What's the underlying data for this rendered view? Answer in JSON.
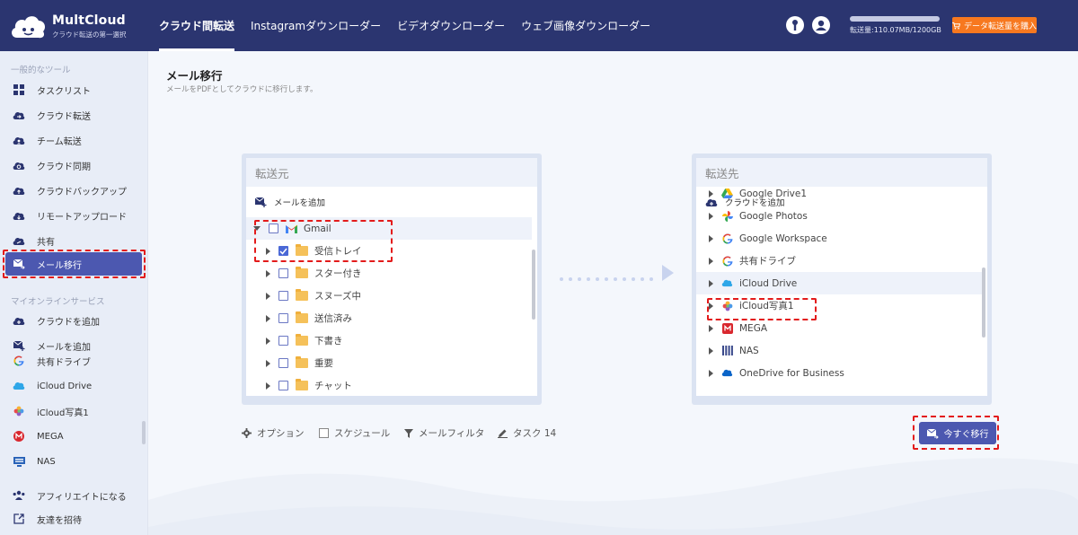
{
  "brand": {
    "name": "MultCloud",
    "tagline": "クラウド転送の第一選択"
  },
  "nav": [
    {
      "label": "クラウド間転送",
      "active": true
    },
    {
      "label": "Instagramダウンローダー"
    },
    {
      "label": "ビデオダウンローダー"
    },
    {
      "label": "ウェブ画像ダウンローダー"
    }
  ],
  "quota": {
    "text": "転送量:110.07MB/1200GB",
    "fraction": 0.0001
  },
  "buy_label": "データ転送量を購入",
  "sidebar": {
    "section1": "一般的なツール",
    "tools": [
      {
        "label": "タスクリスト",
        "icon": "grid-icon"
      },
      {
        "label": "クラウド転送",
        "icon": "cloud-transfer-icon"
      },
      {
        "label": "チーム転送",
        "icon": "team-transfer-icon"
      },
      {
        "label": "クラウド同期",
        "icon": "cloud-sync-icon"
      },
      {
        "label": "クラウドバックアップ",
        "icon": "cloud-backup-icon"
      },
      {
        "label": "リモートアップロード",
        "icon": "remote-upload-icon"
      },
      {
        "label": "共有",
        "icon": "share-icon"
      },
      {
        "label": "メール移行",
        "icon": "email-migration-icon",
        "active": true
      }
    ],
    "section2": "マイオンラインサービス",
    "services": [
      {
        "label": "クラウドを追加",
        "icon": "add-cloud-icon"
      },
      {
        "label": "メールを追加",
        "icon": "add-email-icon"
      },
      {
        "label": "共有ドライブ",
        "icon": "google-icon"
      },
      {
        "label": "iCloud Drive",
        "icon": "icloud-icon"
      },
      {
        "label": "iCloud写真1",
        "icon": "icloud-photos-icon"
      },
      {
        "label": "MEGA",
        "icon": "mega-icon"
      },
      {
        "label": "NAS",
        "icon": "nas-icon"
      }
    ],
    "bottom": [
      {
        "label": "アフィリエイトになる",
        "icon": "affiliate-icon"
      },
      {
        "label": "友達を招待",
        "icon": "invite-icon"
      }
    ]
  },
  "page": {
    "title": "メール移行",
    "subtitle": "メールをPDFとしてクラウドに移行します。"
  },
  "source": {
    "header": "転送元",
    "add_label": "メールを追加",
    "root": "Gmail",
    "folders": [
      {
        "label": "受信トレイ",
        "checked": true
      },
      {
        "label": "スター付き",
        "checked": false
      },
      {
        "label": "スヌーズ中",
        "checked": false
      },
      {
        "label": "送信済み",
        "checked": false
      },
      {
        "label": "下書き",
        "checked": false
      },
      {
        "label": "重要",
        "checked": false
      },
      {
        "label": "チャット",
        "checked": false
      }
    ]
  },
  "target": {
    "header": "転送先",
    "add_label": "クラウドを追加",
    "items": [
      {
        "label": "Google Drive1",
        "icon": "google-drive-icon"
      },
      {
        "label": "Google Photos",
        "icon": "google-photos-icon"
      },
      {
        "label": "Google Workspace",
        "icon": "google-icon"
      },
      {
        "label": "共有ドライブ",
        "icon": "google-icon"
      },
      {
        "label": "iCloud Drive",
        "icon": "icloud-icon",
        "selected": true
      },
      {
        "label": "iCloud写真1",
        "icon": "icloud-photos-icon"
      },
      {
        "label": "MEGA",
        "icon": "mega-icon"
      },
      {
        "label": "NAS",
        "icon": "nas-icon"
      },
      {
        "label": "OneDrive for Business",
        "icon": "onedrive-icon"
      }
    ]
  },
  "options": {
    "option": "オプション",
    "schedule": "スケジュール",
    "filter": "メールフィルタ",
    "task": "タスク 14"
  },
  "migrate_label": "今すぐ移行",
  "colors": {
    "topbar": "#2b3570",
    "accent": "#4c58b0",
    "buy": "#f7781f",
    "highlight": "#e31b1b"
  }
}
